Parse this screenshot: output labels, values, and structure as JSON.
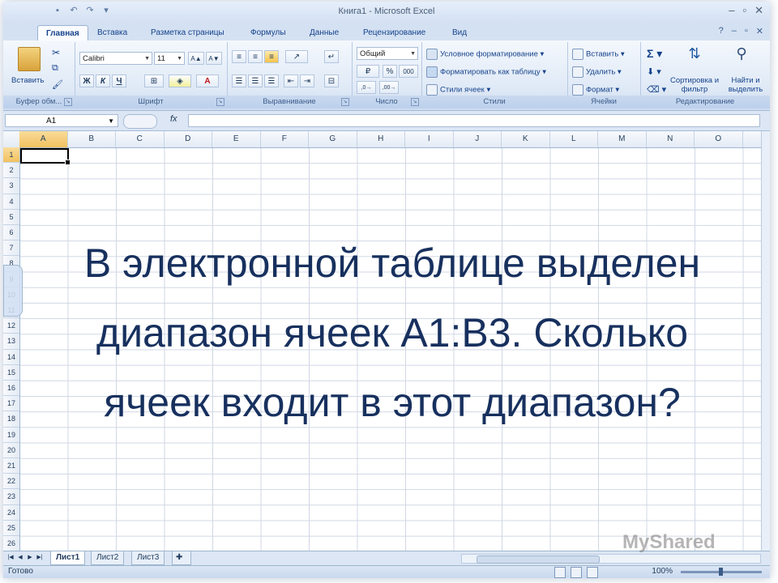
{
  "window": {
    "title": "Книга1 - Microsoft Excel"
  },
  "tabs": [
    "Главная",
    "Вставка",
    "Разметка страницы",
    "Формулы",
    "Данные",
    "Рецензирование",
    "Вид"
  ],
  "ribbon": {
    "clipboard": {
      "paste": "Вставить",
      "label": "Буфер обм..."
    },
    "font": {
      "name": "Calibri",
      "size": "11",
      "bold": "Ж",
      "italic": "К",
      "underline": "Ч",
      "grow": "A▲",
      "shrink": "A▼",
      "color_letter": "A",
      "label": "Шрифт"
    },
    "align": {
      "label": "Выравнивание"
    },
    "number": {
      "format": "Общий",
      "percent": "%",
      "thousands": "000",
      "label": "Число"
    },
    "styles": {
      "conditional": "Условное форматирование",
      "table": "Форматировать как таблицу",
      "cell": "Стили ячеек",
      "label": "Стили"
    },
    "cells": {
      "insert": "Вставить",
      "delete": "Удалить",
      "format": "Формат",
      "label": "Ячейки"
    },
    "editing": {
      "sum": "Σ",
      "sort": "Сортировка и фильтр",
      "find": "Найти и выделить",
      "label": "Редактирование"
    }
  },
  "formula_bar": {
    "name_box": "A1",
    "fx": "fx",
    "value": ""
  },
  "columns": [
    "A",
    "B",
    "C",
    "D",
    "E",
    "F",
    "G",
    "H",
    "I",
    "J",
    "K",
    "L",
    "M",
    "N",
    "O"
  ],
  "rows": [
    "1",
    "2",
    "3",
    "4",
    "5",
    "6",
    "7",
    "8",
    "9",
    "10",
    "11",
    "12",
    "13",
    "14",
    "15",
    "16",
    "17",
    "18",
    "19",
    "20",
    "21",
    "22",
    "23",
    "24",
    "25",
    "26"
  ],
  "overlay_text": "В электронной таблице выделен диапазон ячеек A1:B3. Сколько ячеек входит в этот диапазон?",
  "sheets": [
    "Лист1",
    "Лист2",
    "Лист3"
  ],
  "status": {
    "ready": "Готово",
    "zoom": "100%"
  },
  "watermark": "MyShared"
}
